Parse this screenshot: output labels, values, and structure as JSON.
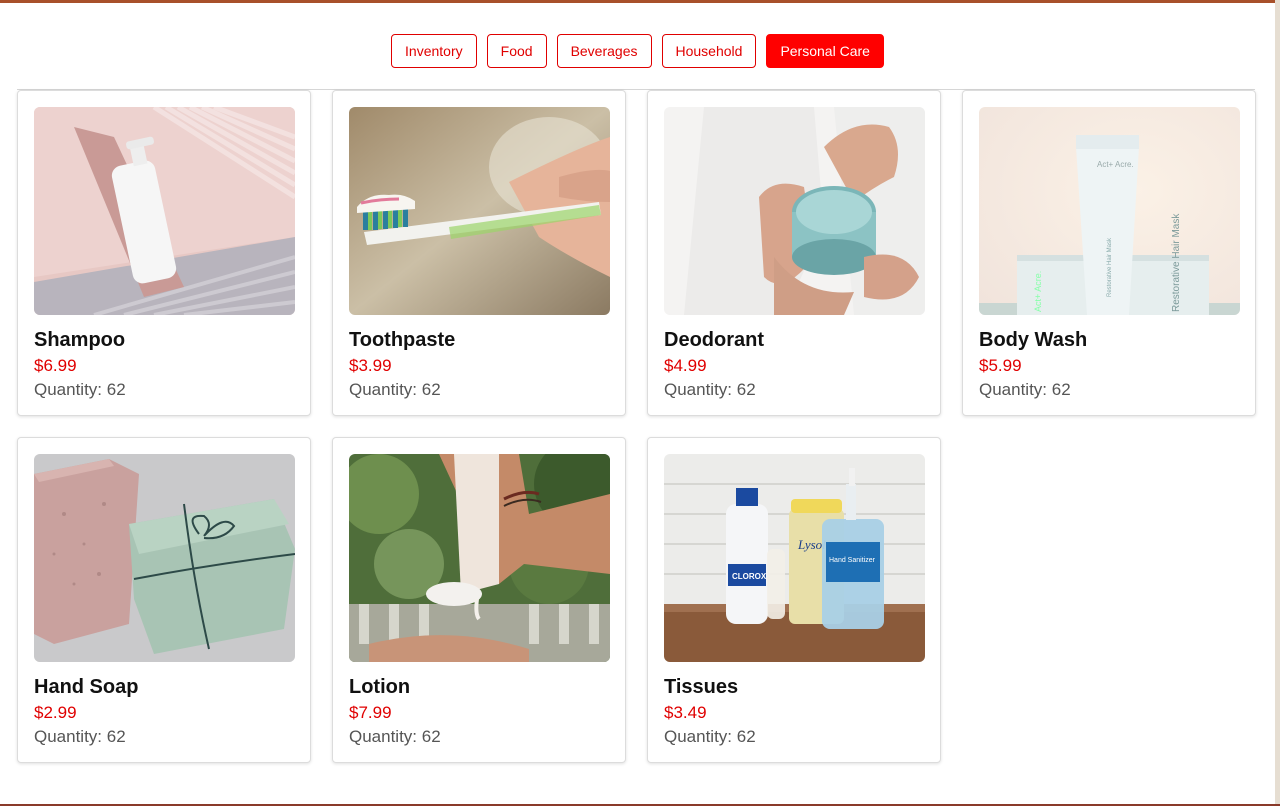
{
  "nav": {
    "tabs": [
      {
        "label": "Inventory",
        "active": false
      },
      {
        "label": "Food",
        "active": false
      },
      {
        "label": "Beverages",
        "active": false
      },
      {
        "label": "Household",
        "active": false
      },
      {
        "label": "Personal Care",
        "active": true
      }
    ]
  },
  "colors": {
    "accent": "#ff0000",
    "price": "#e00000",
    "top_bar": "#a8502a"
  },
  "products": [
    {
      "name": "Shampoo",
      "price": "$6.99",
      "quantity": "Quantity: 62",
      "image": "shampoo-bottle-photo"
    },
    {
      "name": "Toothpaste",
      "price": "$3.99",
      "quantity": "Quantity: 62",
      "image": "toothbrush-toothpaste-photo"
    },
    {
      "name": "Deodorant",
      "price": "$4.99",
      "quantity": "Quantity: 62",
      "image": "cream-jar-photo"
    },
    {
      "name": "Body Wash",
      "price": "$5.99",
      "quantity": "Quantity: 62",
      "image": "body-wash-tube-photo"
    },
    {
      "name": "Hand Soap",
      "price": "$2.99",
      "quantity": "Quantity: 62",
      "image": "soap-bars-photo"
    },
    {
      "name": "Lotion",
      "price": "$7.99",
      "quantity": "Quantity: 62",
      "image": "lotion-tube-photo"
    },
    {
      "name": "Tissues",
      "price": "$3.49",
      "quantity": "Quantity: 62",
      "image": "cleaning-products-photo"
    }
  ],
  "image_text": {
    "body_wash_brand": "Act+ Acre.",
    "body_wash_product": "Restorative Hair Mask",
    "tissues_bottle_1": "CLOROX",
    "tissues_bottle_2": "Lysol",
    "tissues_bottle_3": "Hand Sanitizer"
  }
}
